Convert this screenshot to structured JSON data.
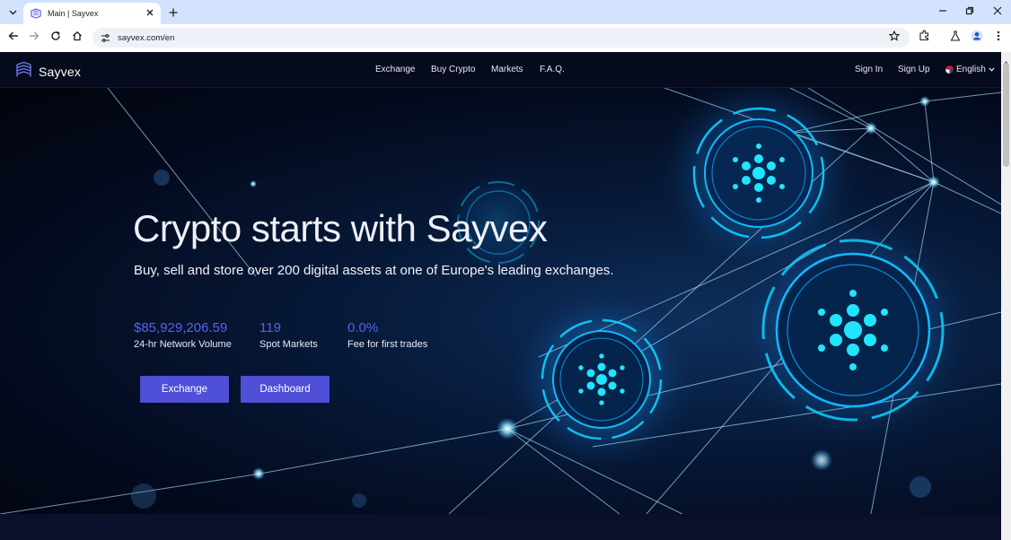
{
  "browser": {
    "tab_title": "Main | Sayvex",
    "url": "sayvex.com/en"
  },
  "site": {
    "brand": "Sayvex",
    "nav": [
      "Exchange",
      "Buy Crypto",
      "Markets",
      "F.A.Q."
    ],
    "sign_in": "Sign In",
    "sign_up": "Sign Up",
    "language": "English"
  },
  "hero": {
    "title": "Crypto starts with Sayvex",
    "subtitle": "Buy, sell and store over 200 digital assets at one of Europe's leading exchanges.",
    "stats": [
      {
        "value": "$85,929,206.59",
        "label": "24-hr Network Volume"
      },
      {
        "value": "119",
        "label": "Spot Markets"
      },
      {
        "value": "0.0%",
        "label": "Fee for first trades"
      }
    ],
    "buttons": {
      "exchange": "Exchange",
      "dashboard": "Dashboard"
    }
  },
  "colors": {
    "accent": "#4f4fd8",
    "stat_value": "#5563f2",
    "header_bg": "#050a1c",
    "hero_glow": "#23c8ff"
  },
  "icons": [
    "tab-dropdown-icon",
    "sayvex-favicon-icon",
    "close-icon",
    "plus-icon",
    "minimize-icon",
    "restore-icon",
    "back-icon",
    "forward-icon",
    "reload-icon",
    "home-icon",
    "site-info-icon",
    "star-icon",
    "extensions-icon",
    "labs-icon",
    "profile-icon",
    "kebab-menu-icon",
    "chevron-down-icon"
  ]
}
